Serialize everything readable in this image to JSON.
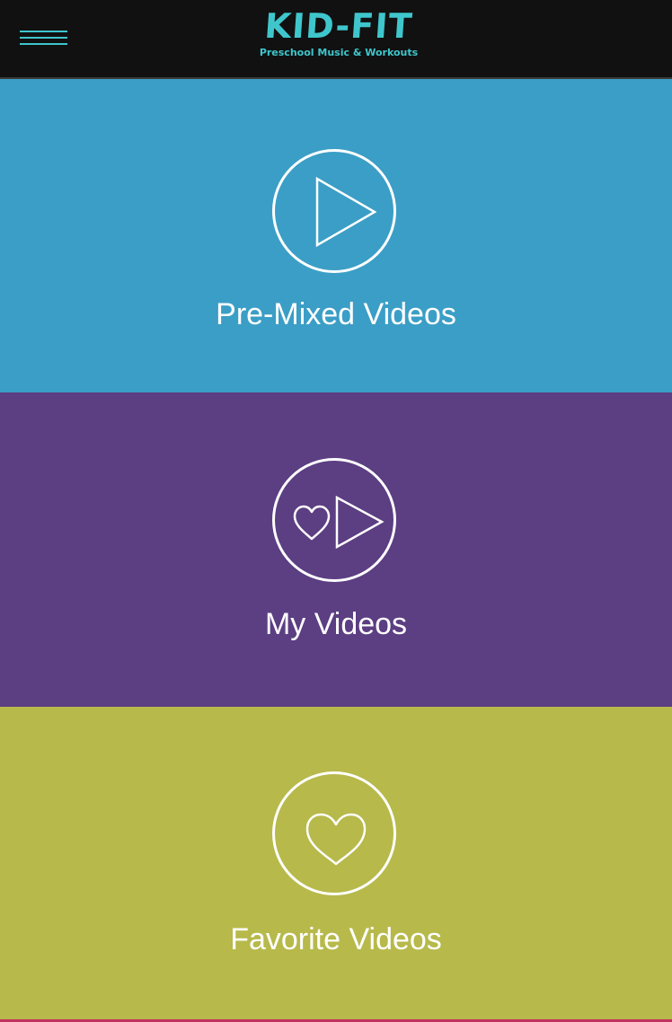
{
  "header": {
    "logo_title": "KID-FIT",
    "logo_subtitle": "Preschool Music & Workouts",
    "menu_icon": "hamburger-menu-icon",
    "accent_color": "#3fc6cc"
  },
  "tiles": [
    {
      "label": "Pre-Mixed Videos",
      "icon": "play-icon",
      "color": "#3b9ec6"
    },
    {
      "label": "My Videos",
      "icon": "heart-play-icon",
      "color": "#5c3e82"
    },
    {
      "label": "Favorite Videos",
      "icon": "heart-icon",
      "color": "#b7b94b"
    }
  ],
  "bottom_accent_color": "#c2315f"
}
